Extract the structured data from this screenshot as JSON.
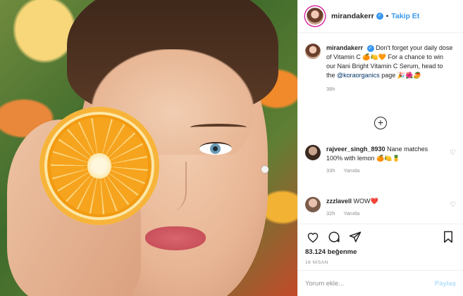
{
  "post": {
    "username": "mirandakerr",
    "follow_label": "Takip Et",
    "separator": "•"
  },
  "caption": {
    "username": "mirandakerr",
    "text": "Don't forget your daily dose of Vitamin C 🍊🍋🧡 For a chance to win our Nani Bright Vitamin C Serum, head to the",
    "mention": "@koraorganics",
    "text_after": "page 🎉🌺🥭",
    "time": "38h"
  },
  "comments": [
    {
      "username": "rajveer_singh_8930",
      "text": "Nane matches 100% with lemon 🍊🍋🍍",
      "time": "33h",
      "reply": "Yanıtla"
    },
    {
      "username": "zzzlavell",
      "text": "WOW❤️",
      "time": "32h",
      "reply": "Yanıtla"
    }
  ],
  "likes": "83.124 beğenme",
  "date": "16 NİSAN",
  "add_comment": {
    "placeholder": "Yorum ekle...",
    "post_label": "Paylaş"
  },
  "icons": {
    "verified": "verified-badge-icon",
    "load_more": "plus-circle-icon",
    "like": "heart-icon",
    "comment": "comment-bubble-icon",
    "share": "paper-plane-icon",
    "save": "bookmark-icon"
  },
  "colors": {
    "accent": "#3897f0",
    "muted": "#8e8e8e",
    "text": "#262626"
  }
}
